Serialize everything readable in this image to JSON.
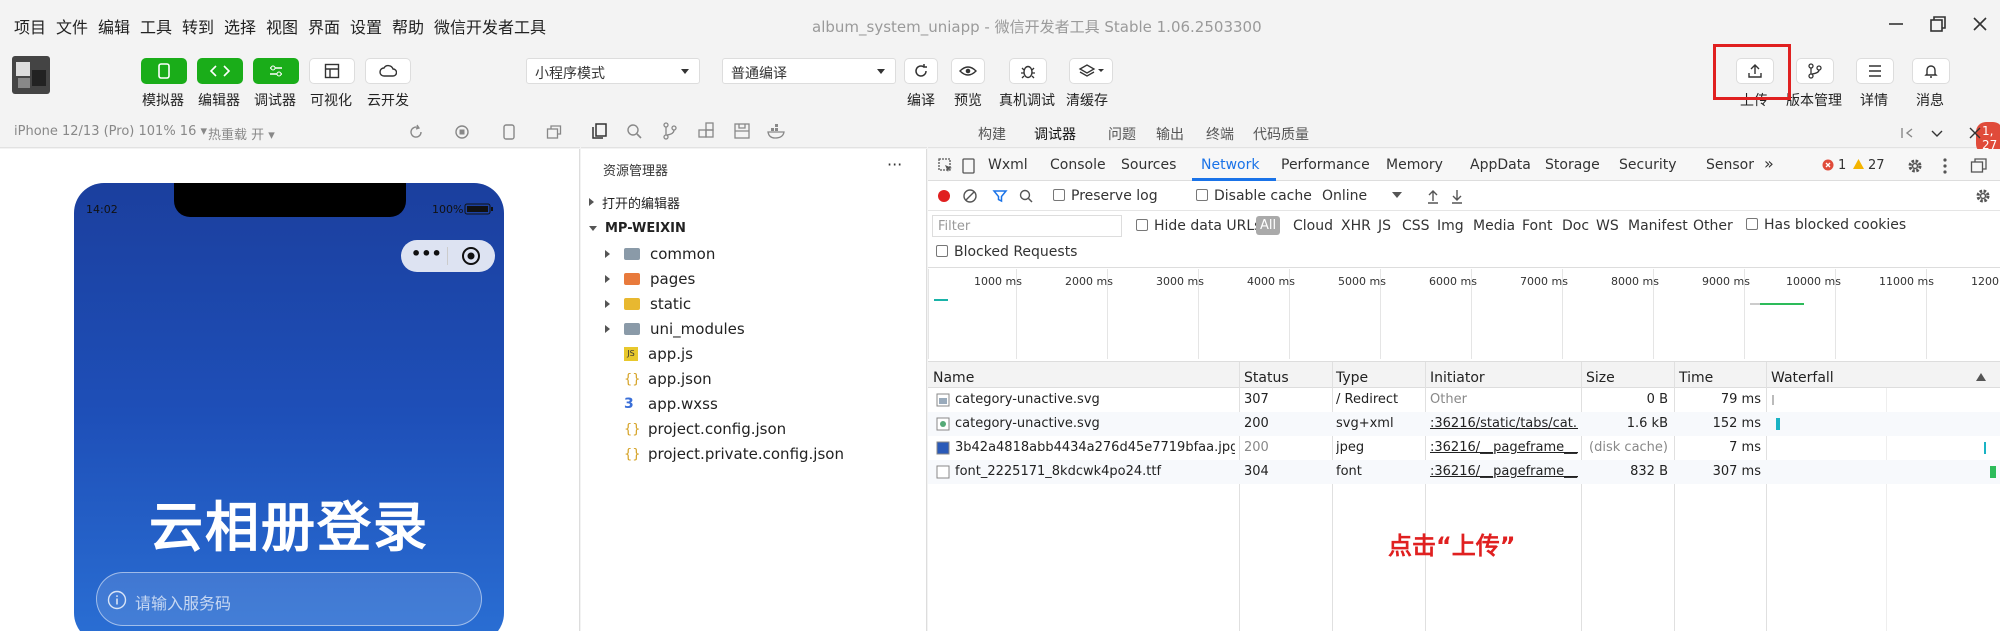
{
  "menu": {
    "items": [
      "项目",
      "文件",
      "编辑",
      "工具",
      "转到",
      "选择",
      "视图",
      "界面",
      "设置",
      "帮助",
      "微信开发者工具"
    ],
    "title": "album_system_uniapp - 微信开发者工具 Stable 1.06.2503300"
  },
  "toolbar": {
    "simulator": "模拟器",
    "editor": "编辑器",
    "debugger": "调试器",
    "visualize": "可视化",
    "cloud": "云开发",
    "mode_select": "小程序模式",
    "compile_select": "普通编译",
    "compile": "编译",
    "preview": "预览",
    "real_debug": "真机调试",
    "clear_cache": "清缓存",
    "upload": "上传",
    "version": "版本管理",
    "details": "详情",
    "messages": "消息"
  },
  "simulator": {
    "device": "iPhone 12/13 (Pro) 101% 16 ▾",
    "hot_reload": "热重载 开 ▾",
    "time": "14:02",
    "battery": "100%",
    "capsule_dots": "•••",
    "login_title": "云相册登录",
    "code_placeholder": "请输入服务码"
  },
  "explorer": {
    "title": "资源管理器",
    "more": "···",
    "open_editors": "打开的编辑器",
    "project": "MP-WEIXIN",
    "folders": [
      "common",
      "pages",
      "static",
      "uni_modules"
    ],
    "files": [
      "app.js",
      "app.json",
      "app.wxss",
      "project.config.json",
      "project.private.config.json"
    ]
  },
  "devtools": {
    "tabs": [
      "构建",
      "调试器",
      "问题",
      "输出",
      "终端",
      "代码质量"
    ],
    "badge": "1, 27",
    "chrome_tabs": [
      "Wxml",
      "Console",
      "Sources",
      "Network",
      "Performance",
      "Memory",
      "AppData",
      "Storage",
      "Security",
      "Sensor"
    ],
    "more_tabs": "»",
    "error_count": "1",
    "warning_count": "27",
    "preserve_log": "Preserve log",
    "disable_cache": "Disable cache",
    "throttle": "Online",
    "filter_placeholder": "Filter",
    "hide_data_urls": "Hide data URLs",
    "types": [
      "All",
      "Cloud",
      "XHR",
      "JS",
      "CSS",
      "Img",
      "Media",
      "Font",
      "Doc",
      "WS",
      "Manifest",
      "Other"
    ],
    "has_blocked_cookies": "Has blocked cookies",
    "blocked_requests": "Blocked Requests",
    "timeline_ticks": [
      "1000 ms",
      "2000 ms",
      "3000 ms",
      "4000 ms",
      "5000 ms",
      "6000 ms",
      "7000 ms",
      "8000 ms",
      "9000 ms",
      "10000 ms",
      "11000 ms",
      "1200"
    ],
    "columns": [
      "Name",
      "Status",
      "Type",
      "Initiator",
      "Size",
      "Time",
      "Waterfall"
    ],
    "rows": [
      {
        "name": "category-unactive.svg",
        "status": "307",
        "type": "/ Redirect",
        "initiator": "Other",
        "size": "0 B",
        "time": "79 ms"
      },
      {
        "name": "category-unactive.svg",
        "status": "200",
        "type": "svg+xml",
        "initiator": ":36216/static/tabs/cat...",
        "size": "1.6 kB",
        "time": "152 ms"
      },
      {
        "name": "3b42a4818abb4434a276d45e7719bfaa.jpg",
        "status": "200",
        "type": "jpeg",
        "initiator": ":36216/__pageframe__...",
        "size": "(disk cache)",
        "time": "7 ms"
      },
      {
        "name": "font_2225171_8kdcwk4po24.ttf",
        "status": "304",
        "type": "font",
        "initiator": ":36216/__pageframe__...",
        "size": "832 B",
        "time": "307 ms"
      }
    ]
  },
  "annotation": "点击“上传”",
  "colors": {
    "green": "#1aad19",
    "red": "#e02020",
    "accent": "#1a73e8"
  }
}
